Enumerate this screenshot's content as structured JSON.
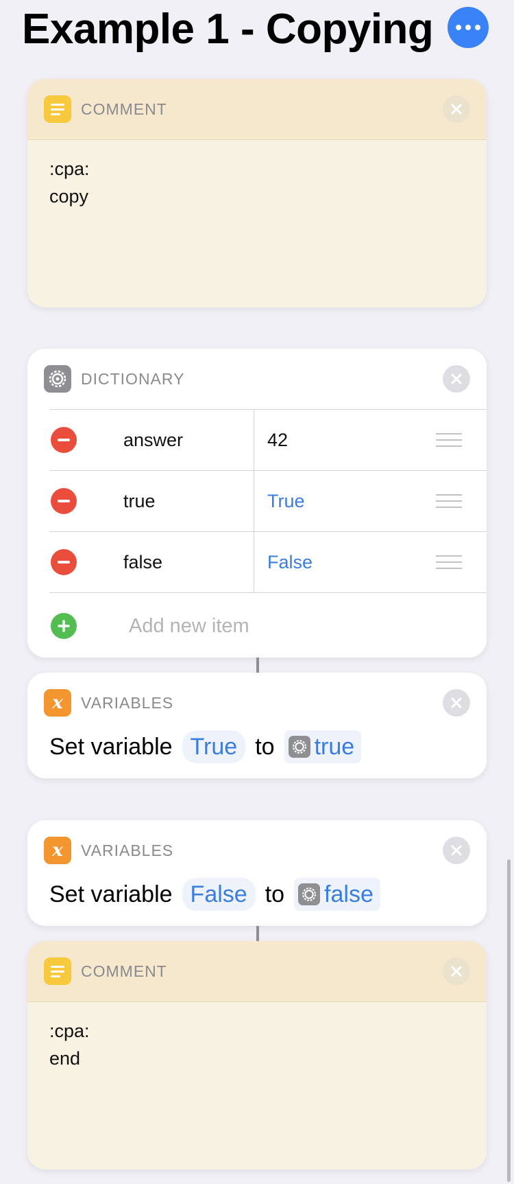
{
  "header": {
    "title": "Example 1 - Copying",
    "more_icon": "ellipsis-icon",
    "accent_color": "#3a82f7"
  },
  "comment_top": {
    "label": "COMMENT",
    "lines": [
      ":cpa:",
      "copy"
    ],
    "icon": "comment-lines-icon"
  },
  "dictionary": {
    "label": "DICTIONARY",
    "icon": "gear-icon",
    "rows": [
      {
        "key": "answer",
        "value": "42"
      },
      {
        "key": "true",
        "value": "True"
      },
      {
        "key": "false",
        "value": "False"
      }
    ],
    "add_label": "Add new item"
  },
  "var_true": {
    "label": "VARIABLES",
    "icon": "variable-x-icon",
    "prefix": "Set variable",
    "name": "True",
    "to": "to",
    "value": "true"
  },
  "var_false": {
    "label": "VARIABLES",
    "icon": "variable-x-icon",
    "prefix": "Set variable",
    "name": "False",
    "to": "to",
    "value": "false"
  },
  "comment_bottom": {
    "label": "COMMENT",
    "lines": [
      ":cpa:",
      "end"
    ],
    "icon": "comment-lines-icon"
  },
  "colors": {
    "remove_red": "#eb4d3d",
    "add_green": "#54bd52",
    "link_blue": "#3a7de0",
    "comment_yellow": "#f9c93d",
    "variables_orange": "#f3962f"
  }
}
